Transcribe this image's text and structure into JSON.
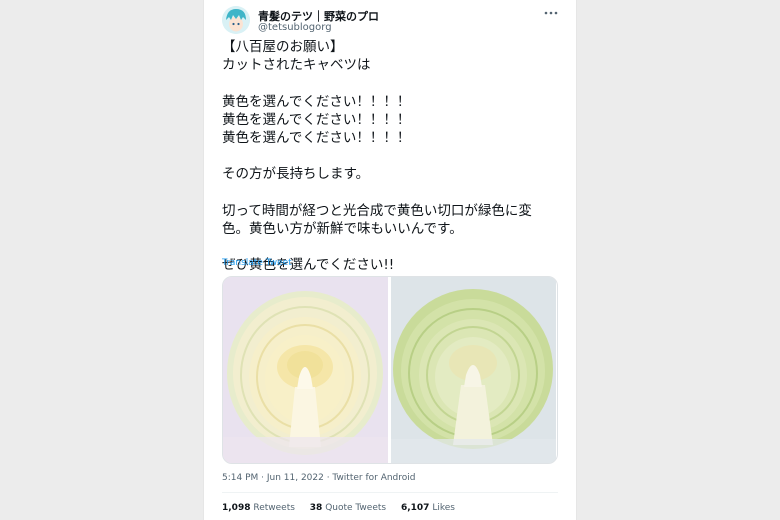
{
  "profile": {
    "display_name": "青髪のテツ｜野菜のプロ",
    "handle": "@tetsublogorg",
    "avatar_icon": "anime-character-avatar-icon"
  },
  "menu": {
    "more_icon": "more-horizontal-icon",
    "more_glyph": "•••"
  },
  "tweet": {
    "text": "【八百屋のお願い】\nカットされたキャベツは\n\n黄色を選んでください！！！！\n黄色を選んでください！！！！\n黄色を選んでください！！！！\n\nその方が長持ちします。\n\n切って時間が経つと光合成で黄色い切口が緑色に変\n色。黄色い方が新鮮で味もいいんです。\n\nぜひ黄色を選んでください!!",
    "translate_label": "Translate Tweet"
  },
  "media": {
    "photos": [
      {
        "description": "yellow-cut-cabbage-photo",
        "tone": "yellow"
      },
      {
        "description": "green-cut-cabbage-photo",
        "tone": "green"
      }
    ]
  },
  "meta": {
    "timestamp": "5:14 PM · Jun 11, 2022 · Twitter for Android"
  },
  "stats": {
    "retweets_count": "1,098",
    "retweets_label": "Retweets",
    "quotes_count": "38",
    "quotes_label": "Quote Tweets",
    "likes_count": "6,107",
    "likes_label": "Likes"
  },
  "colors": {
    "link": "#1d9bf0",
    "text": "#0f1419",
    "secondary": "#536471",
    "avatar_hair": "#3fb5c8"
  }
}
